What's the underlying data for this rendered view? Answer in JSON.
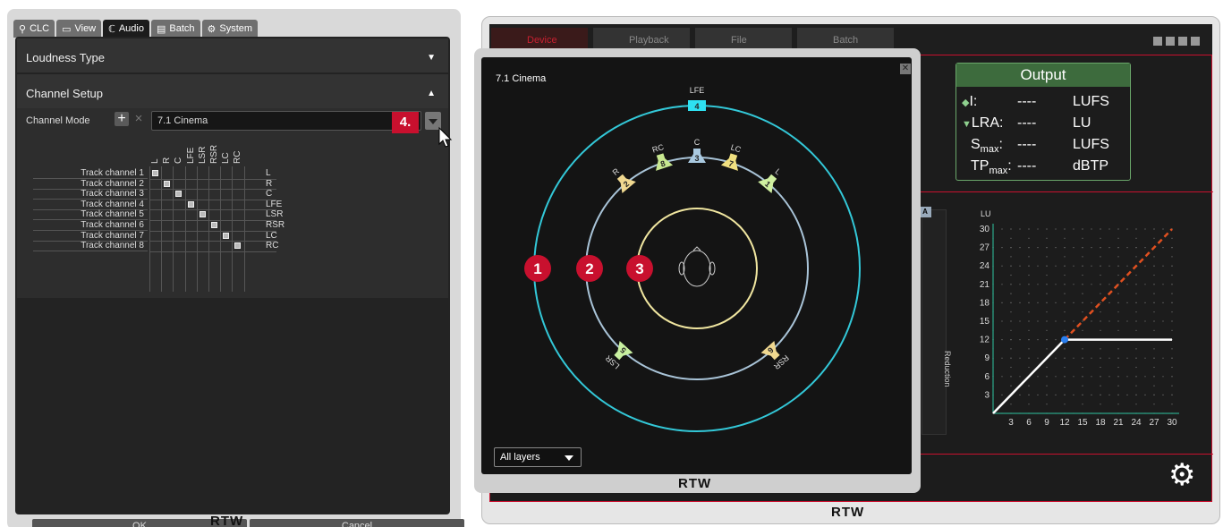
{
  "left": {
    "tabs": [
      {
        "label": "CLC",
        "icon": "clc-icon"
      },
      {
        "label": "View",
        "icon": "view-icon"
      },
      {
        "label": "Audio",
        "icon": "audio-icon"
      },
      {
        "label": "Batch",
        "icon": "batch-icon"
      },
      {
        "label": "System",
        "icon": "gear-icon"
      }
    ],
    "loudness_type": "Loudness Type",
    "channel_setup": "Channel Setup",
    "channel_mode_label": "Channel Mode",
    "channel_mode_value": "7.1 Cinema",
    "step_badge": "4.",
    "columns": [
      "L",
      "R",
      "C",
      "LFE",
      "LSR",
      "RSR",
      "LC",
      "RC"
    ],
    "rows": [
      {
        "track": "Track channel 1",
        "out": "L"
      },
      {
        "track": "Track channel 2",
        "out": "R"
      },
      {
        "track": "Track channel 3",
        "out": "C"
      },
      {
        "track": "Track channel 4",
        "out": "LFE"
      },
      {
        "track": "Track channel 5",
        "out": "LSR"
      },
      {
        "track": "Track channel 6",
        "out": "RSR"
      },
      {
        "track": "Track channel 7",
        "out": "LC"
      },
      {
        "track": "Track channel 8",
        "out": "RC"
      }
    ],
    "ok": "OK",
    "cancel": "Cancel",
    "logo": "RTW"
  },
  "right": {
    "tabs": [
      "Device",
      "Playback",
      "File",
      "Batch"
    ],
    "output": {
      "title": "Output",
      "rows": [
        {
          "key": "I:",
          "value": "----",
          "unit": "LUFS"
        },
        {
          "key": "LRA:",
          "value": "----",
          "unit": "LU"
        },
        {
          "key": "Smax:",
          "value": "----",
          "unit": "LUFS"
        },
        {
          "key": "TPmax:",
          "value": "----",
          "unit": "dBTP"
        }
      ]
    },
    "meter_label": "Reduction",
    "logo": "RTW",
    "chart_data": {
      "type": "line",
      "ylabel": "LU",
      "xlabel": "",
      "y_ticks": [
        3,
        6,
        9,
        12,
        15,
        18,
        21,
        24,
        27,
        30
      ],
      "x_ticks": [
        3,
        6,
        9,
        12,
        15,
        18,
        21,
        24,
        27,
        30
      ],
      "xlim": [
        0,
        30
      ],
      "ylim": [
        0,
        30
      ],
      "series": [
        {
          "x": [
            0,
            12,
            30
          ],
          "y": [
            0,
            12,
            12
          ],
          "color": "#ffffff"
        },
        {
          "x": [
            12,
            30
          ],
          "y": [
            12,
            30
          ],
          "color": "#e05020",
          "dashed": true
        }
      ],
      "knee": {
        "x": 12,
        "y": 12
      }
    }
  },
  "dialog": {
    "title": "7.1 Cinema",
    "speakers": [
      {
        "label": "LFE",
        "num": "4",
        "color": "#2ee0f0"
      },
      {
        "label": "C",
        "num": "3",
        "color": "#a9c9e0"
      },
      {
        "label": "RC",
        "num": "8",
        "color": "#c8e890"
      },
      {
        "label": "LC",
        "num": "7",
        "color": "#f0e080"
      },
      {
        "label": "R",
        "num": "2",
        "color": "#f0d890"
      },
      {
        "label": "L",
        "num": "1",
        "color": "#d0f0a0"
      },
      {
        "label": "LSR",
        "num": "5",
        "color": "#c8f0a0"
      },
      {
        "label": "RSR",
        "num": "6",
        "color": "#f0d890"
      }
    ],
    "layer_markers": [
      "1",
      "2",
      "3"
    ],
    "layer_select": "All layers",
    "logo": "RTW"
  }
}
